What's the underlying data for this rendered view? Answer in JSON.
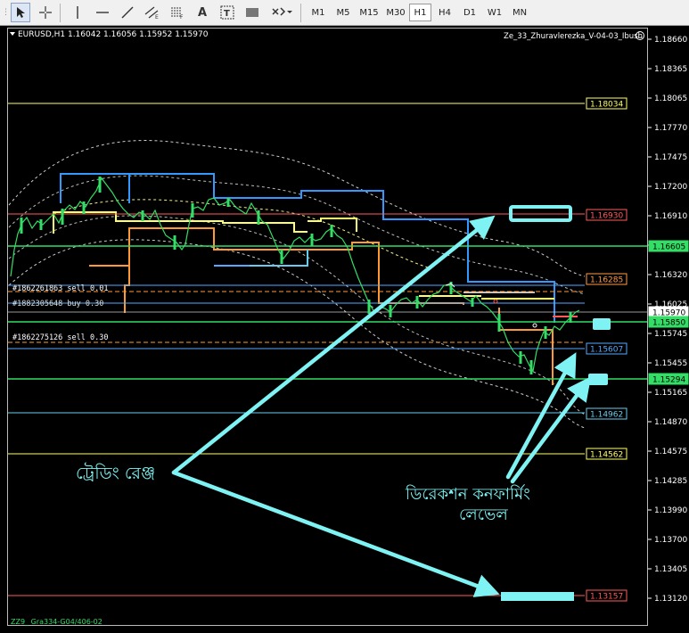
{
  "toolbar": {
    "timeframes": [
      "M1",
      "M5",
      "M15",
      "M30",
      "H1",
      "H4",
      "D1",
      "W1",
      "MN"
    ],
    "active_timeframe": "H1",
    "text_tool_label": "A",
    "label_tool_label": "T"
  },
  "chart": {
    "symbol_info": "EURUSD,H1  1.16042 1.16056 1.15952 1.15970",
    "indicator_name": "Ze_33_Zhuravlerezka_V-04-03_Ibush",
    "footer_text": "ZZ9_ Gra334-G04/406-02",
    "price_axis": [
      "1.18660",
      "1.18365",
      "1.18065",
      "1.17770",
      "1.17475",
      "1.17200",
      "1.16910",
      "1.16615",
      "1.16320",
      "1.16025",
      "1.15745",
      "1.15455",
      "1.15165",
      "1.14870",
      "1.14575",
      "1.14285",
      "1.13990",
      "1.13700",
      "1.13405",
      "1.13120"
    ],
    "level_labels": [
      {
        "text": "1.18034",
        "color": "#ffff66",
        "box": "#000000",
        "border": "#ffff66"
      },
      {
        "text": "1.16930",
        "color": "#ff5a5a",
        "box": "#000000",
        "border": "#ff5a5a"
      },
      {
        "text": "1.16605",
        "color": "#000000",
        "box": "#33dd66",
        "border": "#33dd66"
      },
      {
        "text": "1.16285",
        "color": "#ff9944",
        "box": "#000000",
        "border": "#ff9944"
      },
      {
        "text": "1.15970",
        "color": "#000000",
        "box": "#ffffff",
        "border": "#ffffff"
      },
      {
        "text": "1.15850",
        "color": "#000000",
        "box": "#33dd66",
        "border": "#33dd66"
      },
      {
        "text": "1.15607",
        "color": "#55aaff",
        "box": "#000000",
        "border": "#55aaff"
      },
      {
        "text": "1.15294",
        "color": "#000000",
        "box": "#33dd66",
        "border": "#33dd66"
      },
      {
        "text": "1.14962",
        "color": "#66ccee",
        "box": "#000000",
        "border": "#66ccee"
      },
      {
        "text": "1.14562",
        "color": "#ffff66",
        "box": "#000000",
        "border": "#ffff66"
      },
      {
        "text": "1.13157",
        "color": "#ff5a5a",
        "box": "#000000",
        "border": "#ff5a5a"
      }
    ],
    "orders": [
      "#1862261863 sell 0.01",
      "#1882305648 buy 0.30",
      "#1862275126 sell 0.30"
    ],
    "annotation_trading_range": "ট্রেডিং রেঞ্জ",
    "annotation_direction_line1": "ডিরেকশন কনফার্মিং",
    "annotation_direction_line2": "লেভেল",
    "colors": {
      "annotation": "#7ff3f3",
      "yellow": "#ffff66",
      "green": "#33dd66",
      "red": "#ff5a5a",
      "blue": "#3399ff",
      "orange": "#ff9933"
    }
  }
}
